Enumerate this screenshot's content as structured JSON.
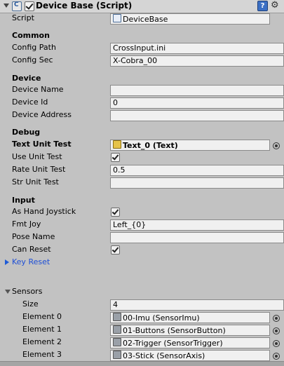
{
  "header": {
    "title": "Device Base (Script)",
    "help": "?",
    "gear": "⚙"
  },
  "script_row": {
    "label": "Script",
    "value": "DeviceBase"
  },
  "common": {
    "title": "Common",
    "config_path": {
      "label": "Config Path",
      "value": "CrossInput.ini"
    },
    "config_sec": {
      "label": "Config Sec",
      "value": "X-Cobra_00"
    }
  },
  "device": {
    "title": "Device",
    "device_name": {
      "label": "Device Name",
      "value": ""
    },
    "device_id": {
      "label": "Device Id",
      "value": "0"
    },
    "device_address": {
      "label": "Device Address",
      "value": ""
    }
  },
  "debug": {
    "title": "Debug",
    "text_unit_test": {
      "label": "Text Unit Test",
      "value": "Text_0 (Text)"
    },
    "use_unit_test": {
      "label": "Use Unit Test",
      "checked": true
    },
    "rate_unit_test": {
      "label": "Rate Unit Test",
      "value": "0.5"
    },
    "str_unit_test": {
      "label": "Str Unit Test",
      "value": ""
    }
  },
  "input": {
    "title": "Input",
    "as_hand_joystick": {
      "label": "As Hand Joystick",
      "checked": true
    },
    "fmt_joy": {
      "label": "Fmt Joy",
      "value": "Left_{0}"
    },
    "pose_name": {
      "label": "Pose Name",
      "value": ""
    },
    "can_reset": {
      "label": "Can Reset",
      "checked": true
    },
    "key_reset": {
      "label": "Key Reset"
    }
  },
  "sensors": {
    "label": "Sensors",
    "size": {
      "label": "Size",
      "value": "4"
    },
    "elements": [
      {
        "label": "Element 0",
        "value": "00-Imu (SensorImu)"
      },
      {
        "label": "Element 1",
        "value": "01-Buttons (SensorButton)"
      },
      {
        "label": "Element 2",
        "value": "02-Trigger (SensorTrigger)"
      },
      {
        "label": "Element 3",
        "value": "03-Stick (SensorAxis)"
      }
    ]
  }
}
